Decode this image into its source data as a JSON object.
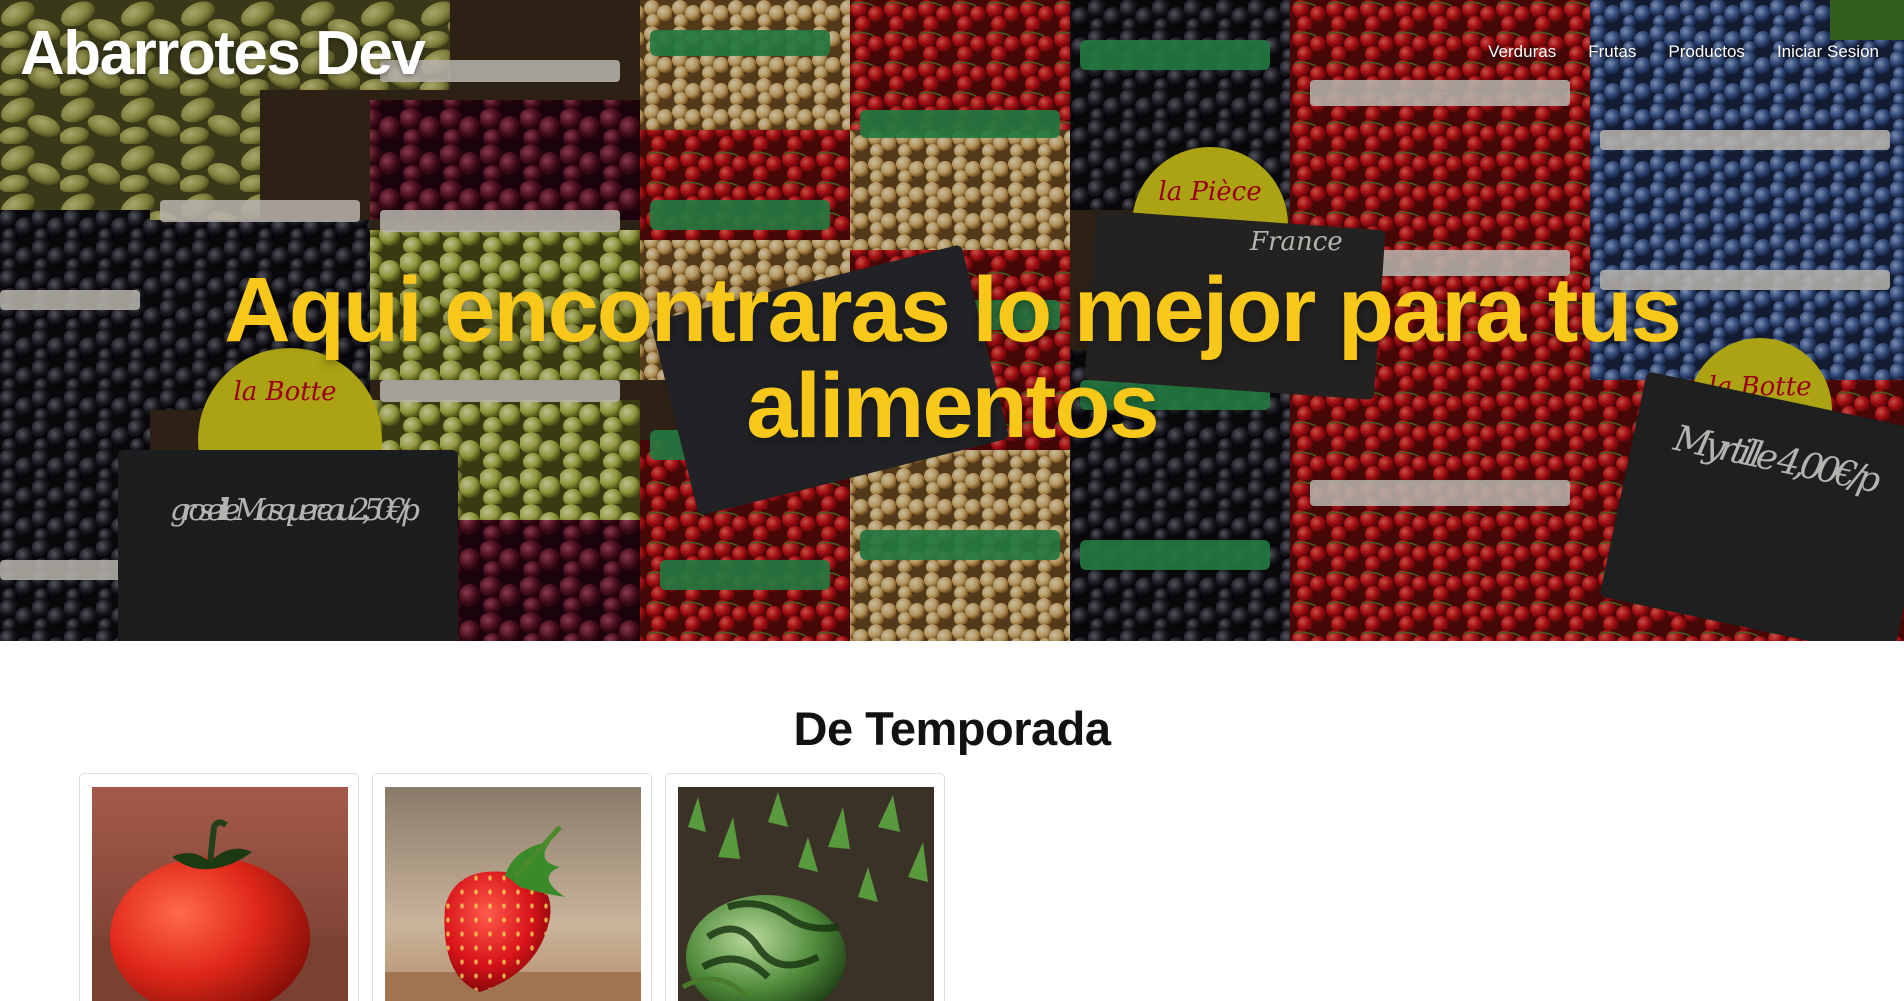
{
  "brand": "Abarrotes Dev",
  "nav": {
    "items": [
      {
        "label": "Verduras"
      },
      {
        "label": "Frutas"
      },
      {
        "label": "Productos"
      },
      {
        "label": "Iniciar Sesion"
      }
    ]
  },
  "hero": {
    "title": "Aqui encontraras lo mejor para tus alimentos",
    "sign_texts": [
      "la Botte",
      "groseille Masquereau 2,50€/p",
      "la Pièce",
      "France",
      "la Botte",
      "Myrtille 4,00€/p"
    ]
  },
  "section": {
    "title": "De Temporada",
    "cards": [
      {
        "image": "tomato"
      },
      {
        "image": "strawberry"
      },
      {
        "image": "watermelon"
      }
    ]
  },
  "colors": {
    "accent_yellow": "#f7c719",
    "nav_text": "#ffffff"
  }
}
